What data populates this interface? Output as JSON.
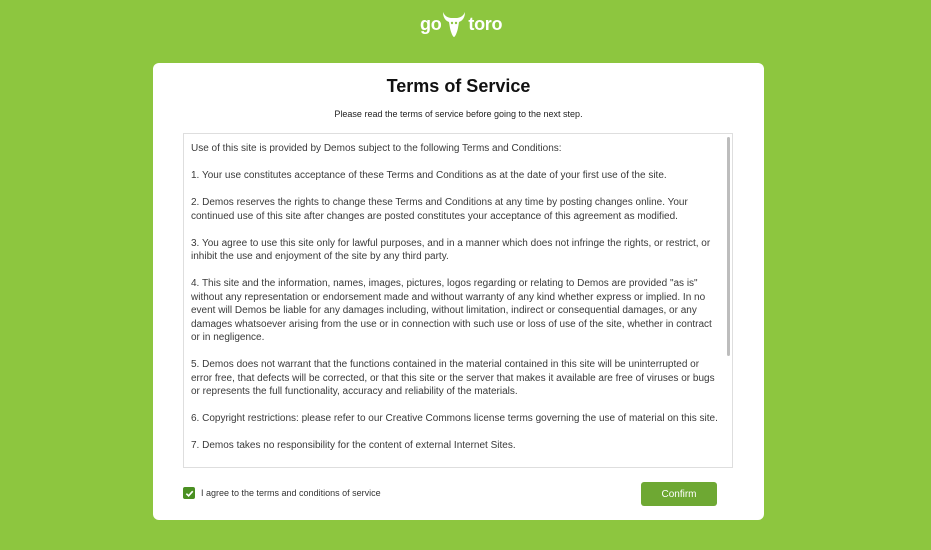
{
  "logo": {
    "prefix": "go",
    "suffix": "toro"
  },
  "card": {
    "title": "Terms of Service",
    "subtitle": "Please read the terms of service before going to the next step."
  },
  "terms": [
    "Use of this site is provided by Demos subject to the following Terms and Conditions:",
    "1. Your use constitutes acceptance of these Terms and Conditions as at the date of your first use of the site.",
    "2. Demos reserves the rights to change these Terms and Conditions at any time by posting changes online. Your continued use of this site after changes are posted constitutes your acceptance of this agreement as modified.",
    "3. You agree to use this site only for lawful purposes, and in a manner which does not infringe the rights, or restrict, or inhibit the use and enjoyment of the site by any third party.",
    "4. This site and the information, names, images, pictures, logos regarding or relating to Demos are provided \"as is\" without any representation or endorsement made and without warranty of any kind whether express or implied. In no event will Demos be liable for any damages including, without limitation, indirect or consequential damages, or any damages whatsoever arising from the use or in connection with such use or loss of use of the site, whether in contract or in negligence.",
    "5. Demos does not warrant that the functions contained in the material contained in this site will be uninterrupted or error free, that defects will be corrected, or that this site or the server that makes it available are free of viruses or bugs or represents the full functionality, accuracy and reliability of the materials.",
    "6. Copyright restrictions: please refer to our Creative Commons license terms governing the use of material on this site.",
    "7. Demos takes no responsibility for the content of external Internet Sites."
  ],
  "agreement": {
    "checked": true,
    "label": "I agree to the terms and conditions of service"
  },
  "confirm_button": {
    "label": "Confirm"
  },
  "colors": {
    "background": "#8dc63f",
    "card": "#ffffff",
    "checkbox": "#4a8f22",
    "button": "#6ea833"
  },
  "icons": {
    "logo": "bull-head-icon",
    "checkbox": "checkmark-icon"
  }
}
